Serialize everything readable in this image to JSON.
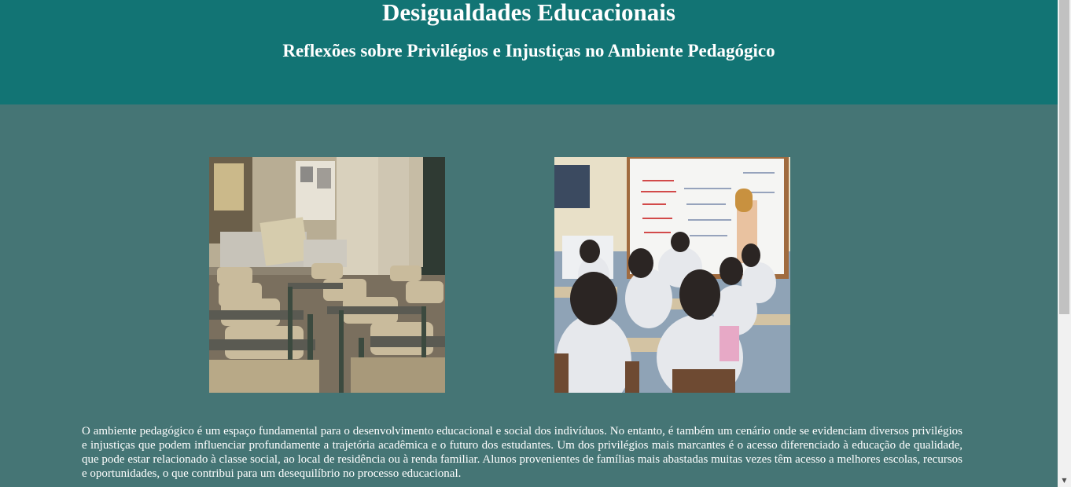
{
  "header": {
    "title": "Desigualdades Educacionais",
    "subtitle": "Reflexões sobre Privilégios e Injustiças no Ambiente Pedagógico"
  },
  "images": [
    {
      "name": "empty-classroom-photo"
    },
    {
      "name": "students-at-whiteboard-photo"
    }
  ],
  "content": {
    "paragraph": "O ambiente pedagógico é um espaço fundamental para o desenvolvimento educacional e social dos indivíduos. No entanto, é também um cenário onde se evidenciam diversos privilégios e injustiças que podem influenciar profundamente a trajetória acadêmica e o futuro dos estudantes. Um dos privilégios mais marcantes é o acesso diferenciado à educação de qualidade, que pode estar relacionado à classe social, ao local de residência ou à renda familiar. Alunos provenientes de famílias mais abastadas muitas vezes têm acesso a melhores escolas, recursos e oportunidades, o que contribui para um desequilíbrio no processo educacional."
  },
  "scrollbar": {
    "down_arrow": "▼"
  },
  "colors": {
    "header_bg": "#127474",
    "page_bg": "#457575",
    "text": "#ffffff"
  }
}
